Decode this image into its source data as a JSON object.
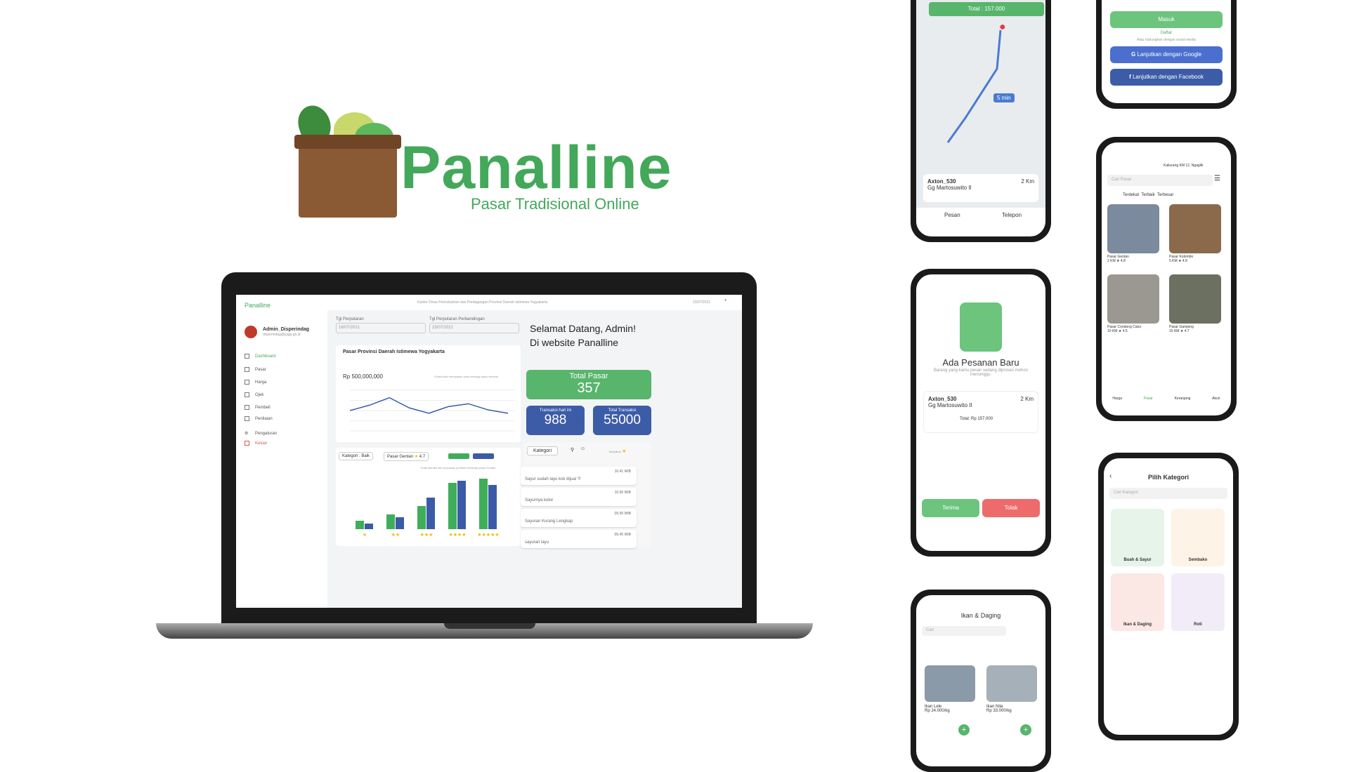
{
  "brand": {
    "name": "Panalline",
    "tagline": "Pasar Tradisional Online"
  },
  "dashboard": {
    "app_name": "Panalline",
    "header_info": "Kantor Dinas Perindustrian dan Perdagangan Provinsi Daerah Istimewa Yogyakarta",
    "header_date": "23/07/2021",
    "user": {
      "name": "Admin_Disperindag",
      "email": "disperindag@jogja.go.id"
    },
    "nav": [
      "Dashboard",
      "Pasar",
      "Harga",
      "Ojek",
      "Pembeli",
      "Penilaian",
      "Pengaturan",
      "Keluar"
    ],
    "date_label_1": "Tgl Perputaran",
    "date_value_1": "16/07/2021",
    "date_label_2": "Tgl Perputaran Perbandingan",
    "date_value_2": "23/07/2021",
    "welcome": "Selamat Datang, Admin!",
    "welcome_2": "Di website Panalline",
    "line_title": "Pasar Provinsi Daerah Istimewa Yogyakarta",
    "line_value": "Rp 500,000,000",
    "line_note": "*Data hasil merupakan pada rentang waktu tertentu",
    "stats": {
      "total_pasar_label": "Total Pasar",
      "total_pasar": "357",
      "trans_today_label": "Transaksi hari ini",
      "trans_today": "988",
      "total_trans_label": "Total Transaksi",
      "total_trans": "55000"
    },
    "filter_kategori": "Kategori : Baik",
    "filter_pasar": "Pasar Gentan",
    "filter_rating": "4.7",
    "bar_note": "*Data diambil dari kepuasan pembeli terhadap pasar Gentan",
    "stars": [
      "★",
      "★★",
      "★★★",
      "★★★★",
      "★★★★★"
    ],
    "kategori_label": "Kategori",
    "tampilkan": "Tampilkan",
    "messages": [
      {
        "text": "Sayur sudah layu kok dijual ?!",
        "time": "10.41 WIB"
      },
      {
        "text": "Sayurnya kotor",
        "time": "10.55 WIB"
      },
      {
        "text": "Sayuran Kurang Lengkap",
        "time": "09.55 WIB"
      },
      {
        "text": "sayuran layu",
        "time": "09.45 WIB"
      }
    ]
  },
  "chart_data": {
    "type": "line",
    "series": [
      {
        "values": [
          3,
          3.8,
          4.9,
          3.4,
          2.6,
          3.6,
          4,
          3.1,
          2.6
        ]
      }
    ],
    "ylim": [
      0,
      6
    ]
  },
  "chart_data_bars": {
    "type": "bar",
    "categories": [
      "★",
      "★★",
      "★★★",
      "★★★★",
      "★★★★★"
    ],
    "series": [
      {
        "color": "#3fae5a",
        "values": [
          20,
          35,
          55,
          110,
          120
        ]
      },
      {
        "color": "#3b5ba8",
        "values": [
          14,
          28,
          75,
          115,
          105
        ]
      }
    ]
  },
  "phone_map": {
    "total": "Total : 157.000",
    "eta": "5 min",
    "driver": "Axton_530",
    "address": "Gg Martosuwito II",
    "distance": "2 Km",
    "pesan": "Pesan",
    "telepon": "Telepon"
  },
  "phone_login": {
    "masuk": "Masuk",
    "daftar": "Daftar",
    "or": "Atau hubungkan dengan sosial media",
    "google": "Lanjutkan dengan Google",
    "facebook": "Lanjutkan dengan Facebook"
  },
  "phone_order": {
    "title": "Ada Pesanan Baru",
    "sub": "Barang yang kamu pesan sedang diproses mohon menunggu.",
    "driver": "Axton_530",
    "address": "Gg Martosuwito II",
    "distance": "2 Km",
    "total": "Total: Rp 157.000",
    "terima": "Terima",
    "tolak": "Tolak"
  },
  "phone_pasar": {
    "location": "Kaliurang KM 12, Ngaglik",
    "search": "Cari Pasar",
    "tabs": [
      "Terdekat",
      "Terbaik",
      "Terbesar"
    ],
    "markets": [
      {
        "name": "Pasar Gentan",
        "info": "2 KM ★ 4.8"
      },
      {
        "name": "Pasar Kolombo",
        "info": "5 KM ★ 4.8"
      },
      {
        "name": "Pasar Condong Catur",
        "info": "10 KM ★ 4.5"
      },
      {
        "name": "Pasar Gamping",
        "info": "15 KM ★ 4.7"
      }
    ],
    "nav": [
      "Harga",
      "Pasar",
      "Keranjang",
      "Akun"
    ]
  },
  "phone_kategori": {
    "title": "Pilih Kategori",
    "search": "Cari Kategori",
    "cats": [
      "Buah & Sayur",
      "Sembako",
      "Ikan & Daging",
      "Roti"
    ]
  },
  "phone_ikan": {
    "title": "Ikan & Daging",
    "search": "Cari",
    "items": [
      {
        "name": "Ikan Lele",
        "price": "Rp 24.000/kg"
      },
      {
        "name": "Ikan Nila",
        "price": "Rp 33.000/kg"
      }
    ]
  }
}
